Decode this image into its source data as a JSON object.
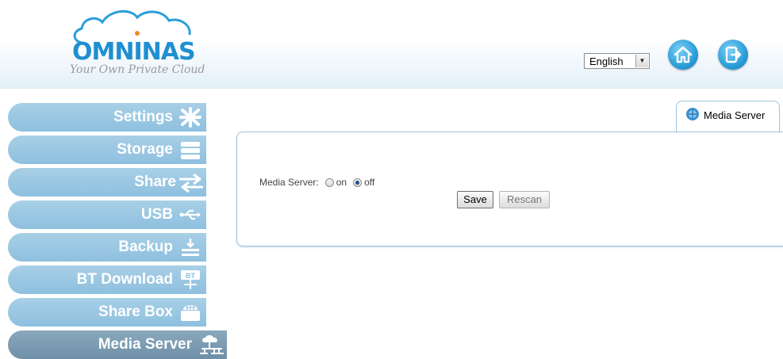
{
  "header": {
    "logo_name": "OMNINAS",
    "logo_tagline": "Your Own Private Cloud",
    "language": "English",
    "home_icon": "home-icon",
    "logout_icon": "logout-icon"
  },
  "sidebar": {
    "items": [
      {
        "label": "Settings",
        "icon": "settings-icon",
        "active": false
      },
      {
        "label": "Storage",
        "icon": "storage-icon",
        "active": false
      },
      {
        "label": "Share",
        "icon": "share-icon",
        "active": false
      },
      {
        "label": "USB",
        "icon": "usb-icon",
        "active": false
      },
      {
        "label": "Backup",
        "icon": "backup-icon",
        "active": false
      },
      {
        "label": "BT Download",
        "icon": "bt-download-icon",
        "active": false
      },
      {
        "label": "Share Box",
        "icon": "share-box-icon",
        "active": false
      },
      {
        "label": "Media Server",
        "icon": "media-server-icon",
        "active": true
      }
    ]
  },
  "content": {
    "tab_label": "Media Server",
    "media_server_label": "Media Server:",
    "option_on": "on",
    "option_off": "off",
    "selected": "off",
    "save_label": "Save",
    "rescan_label": "Rescan"
  },
  "colors": {
    "accent": "#1f8fd0",
    "sidebar": "#9dc8e2",
    "sidebar_active": "#7d9cb3",
    "panel_border": "#9cc3dd"
  }
}
